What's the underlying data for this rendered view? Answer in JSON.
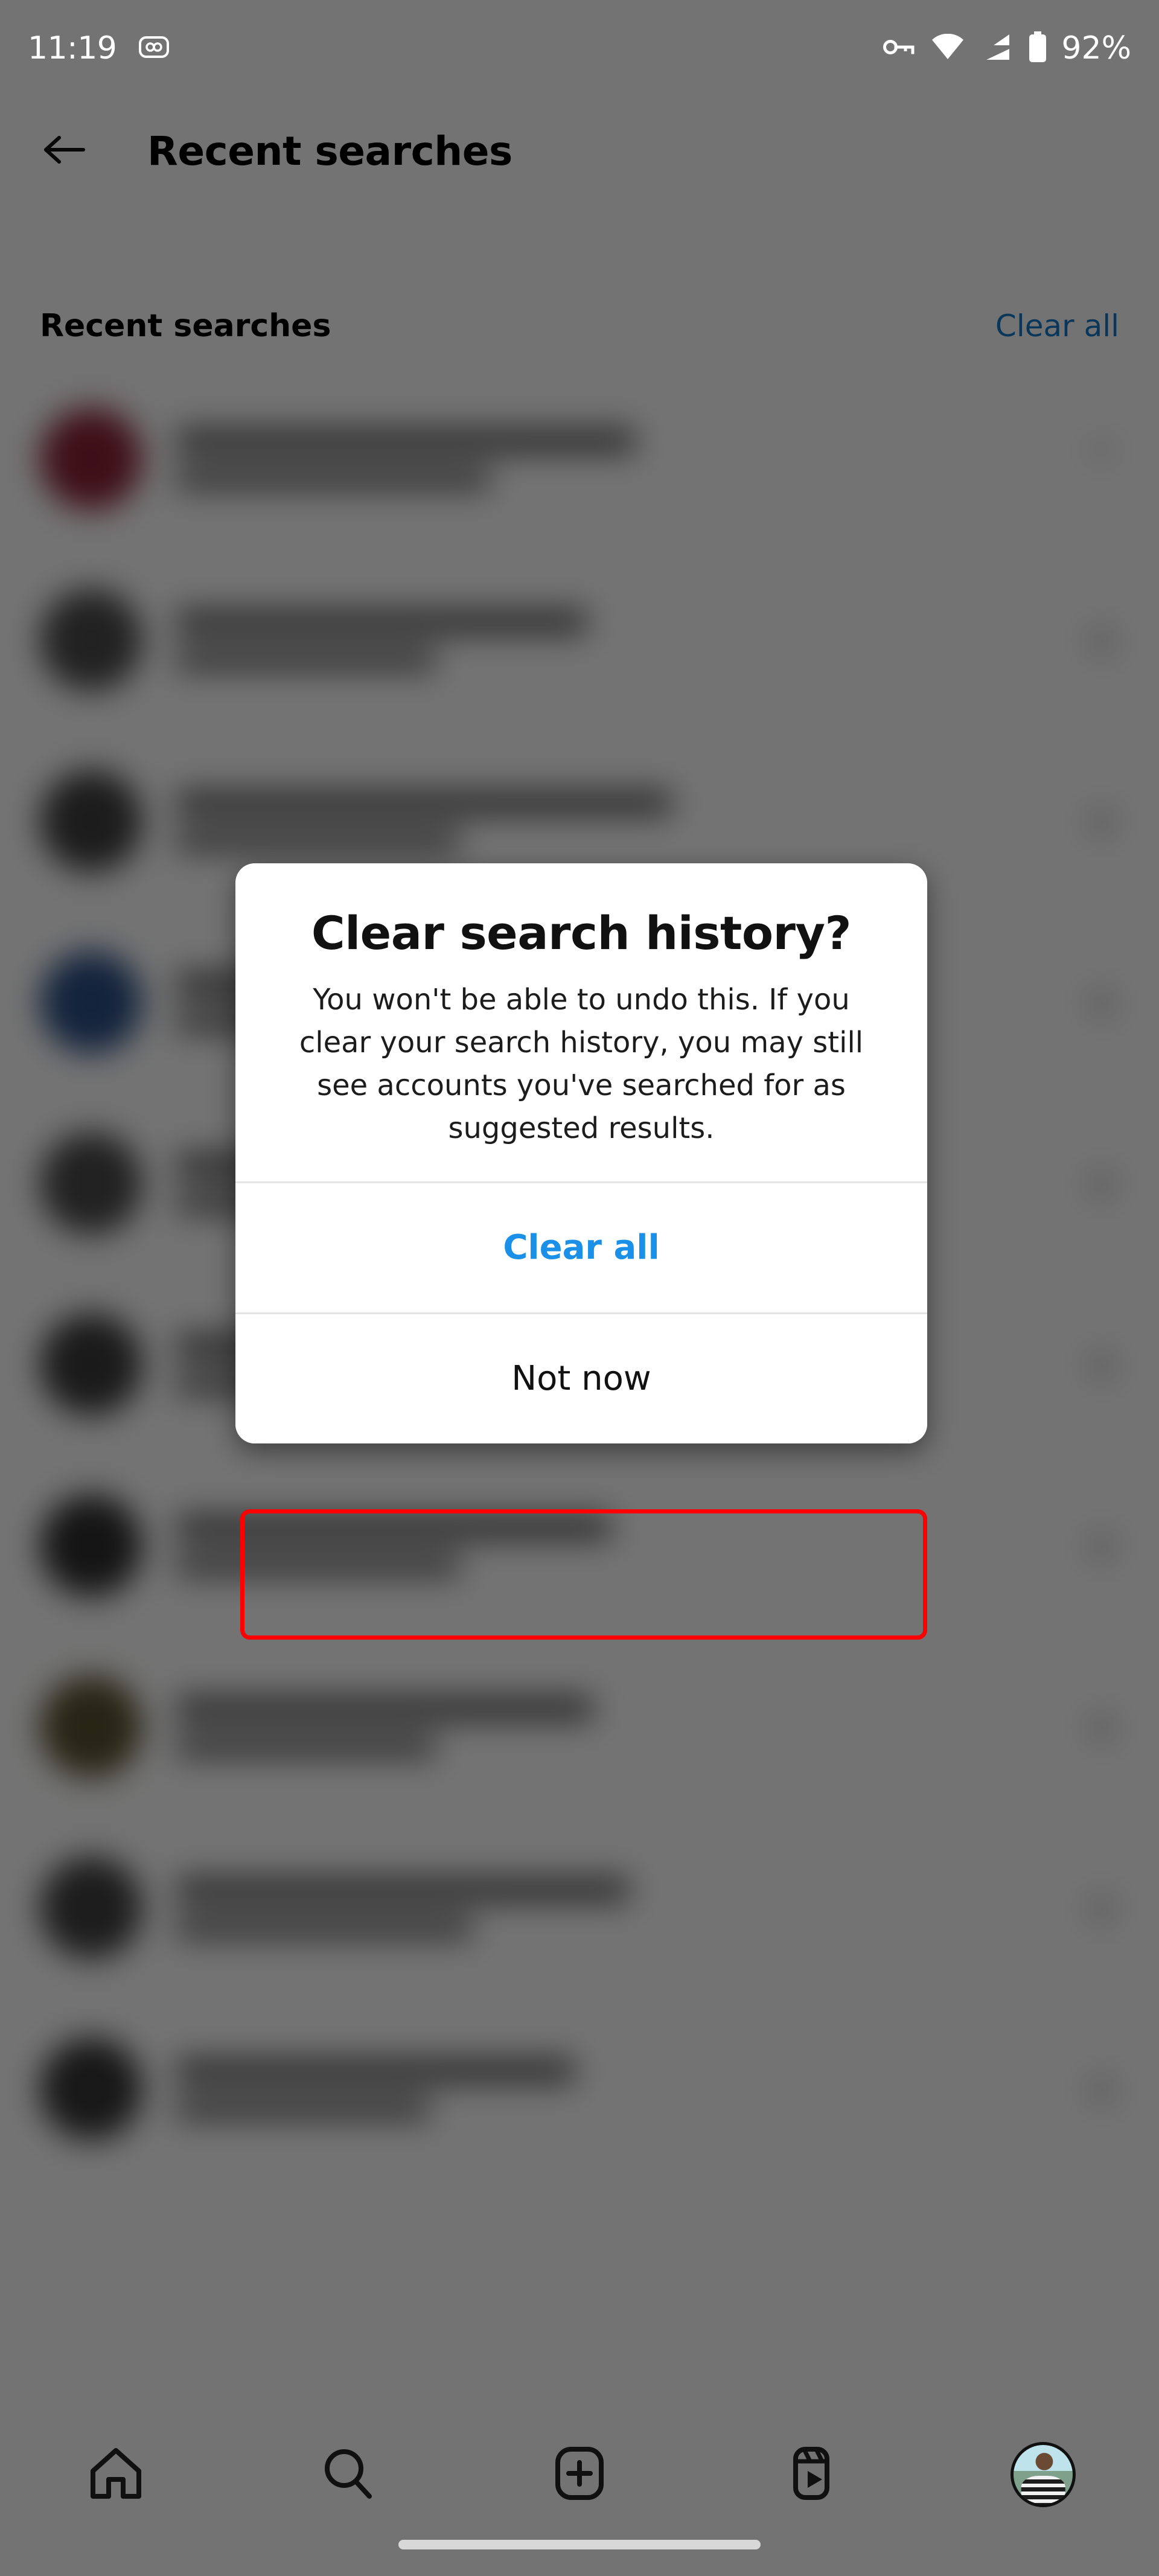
{
  "status_bar": {
    "time": "11:19",
    "battery_percent": "92%",
    "icons": [
      "notification-card-icon",
      "vpn-key-icon",
      "wifi-icon",
      "mobile-signal-icon",
      "battery-icon"
    ]
  },
  "app_bar": {
    "back_label": "back-arrow",
    "title": "Recent searches"
  },
  "section": {
    "title": "Recent searches",
    "clear_all_label": "Clear all"
  },
  "search_list": {
    "blurred": true,
    "rows": [
      {
        "remove_label": "chevron-up"
      },
      {
        "remove_label": "×"
      },
      {
        "remove_label": "×"
      },
      {
        "remove_label": "×"
      },
      {
        "remove_label": "×"
      }
    ]
  },
  "dialog": {
    "title": "Clear search history?",
    "description": "You won't be able to undo this. If you clear your search history, you may still see accounts you've searched for as suggested results.",
    "primary_button": "Clear all",
    "secondary_button": "Not now",
    "primary_color": "#1b90e8",
    "highlight_color": "#ff0000"
  },
  "bottom_nav": {
    "items": [
      {
        "name": "home",
        "icon": "home-icon"
      },
      {
        "name": "search",
        "icon": "search-icon"
      },
      {
        "name": "create",
        "icon": "plus-square-icon"
      },
      {
        "name": "reels",
        "icon": "reels-icon"
      },
      {
        "name": "profile",
        "icon": "profile-avatar"
      }
    ]
  }
}
